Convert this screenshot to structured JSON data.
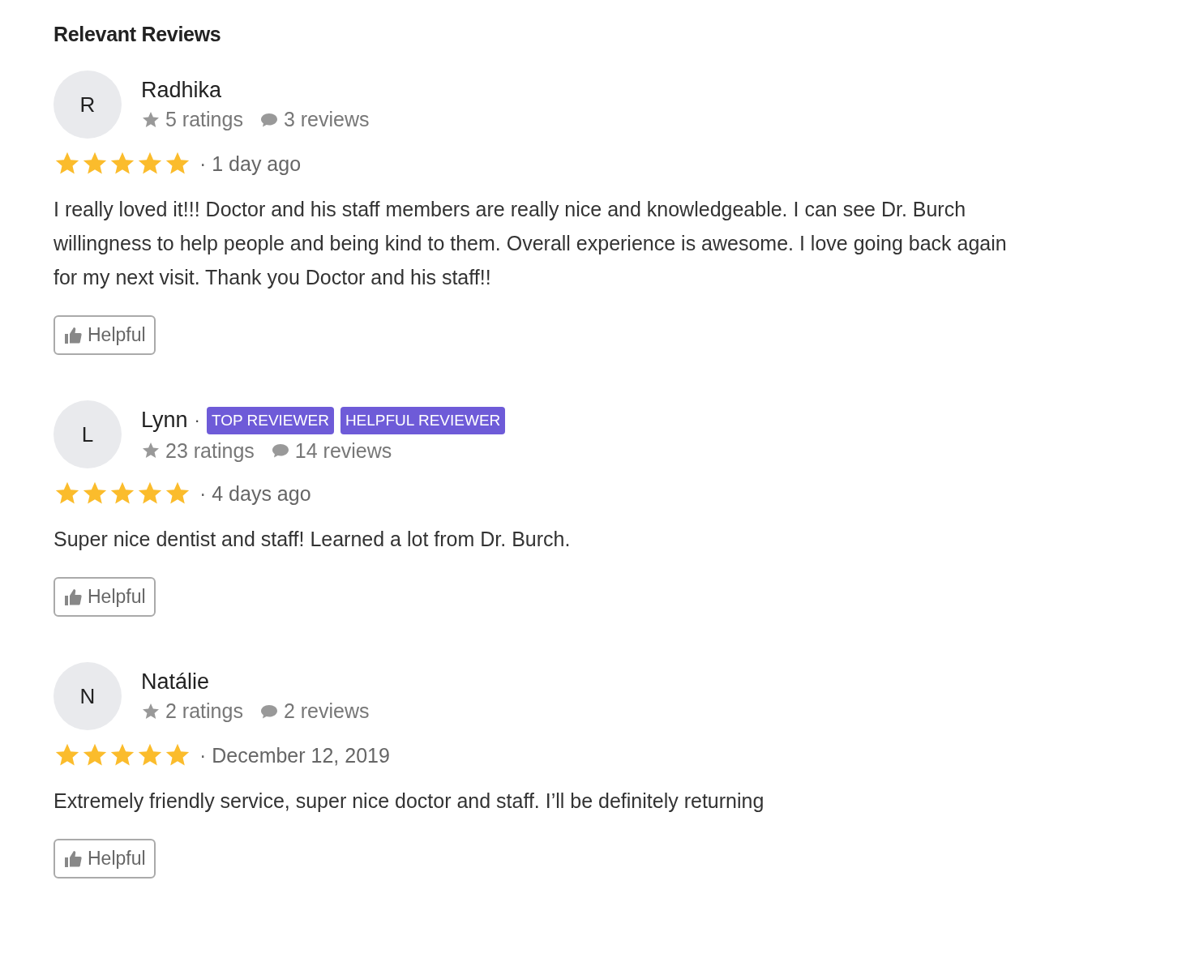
{
  "title": "Relevant Reviews",
  "reviews": [
    {
      "initial": "R",
      "name": "Radhika",
      "ratings": "5 ratings",
      "review_count": "3 reviews",
      "stars": 5,
      "date": "· 1 day ago",
      "text": "I really loved it!!! Doctor and his staff members are really nice and knowledgeable. I can see Dr. Burch willingness to help people and being kind to them. Overall experience is awesome. I love going back again for my next visit. Thank you Doctor and his staff!!",
      "helpful": "Helpful"
    },
    {
      "initial": "L",
      "name": "Lynn",
      "separator": "·",
      "badges": [
        "TOP REVIEWER",
        "HELPFUL REVIEWER"
      ],
      "ratings": "23 ratings",
      "review_count": "14 reviews",
      "stars": 5,
      "date": "· 4 days ago",
      "text": "Super nice dentist and staff! Learned a lot from Dr. Burch.",
      "helpful": "Helpful"
    },
    {
      "initial": "N",
      "name": "Natálie",
      "ratings": "2 ratings",
      "review_count": "2 reviews",
      "stars": 5,
      "date": "· December 12, 2019",
      "text": "Extremely friendly service, super nice doctor and staff. I’ll be definitely returning",
      "helpful": "Helpful"
    }
  ]
}
